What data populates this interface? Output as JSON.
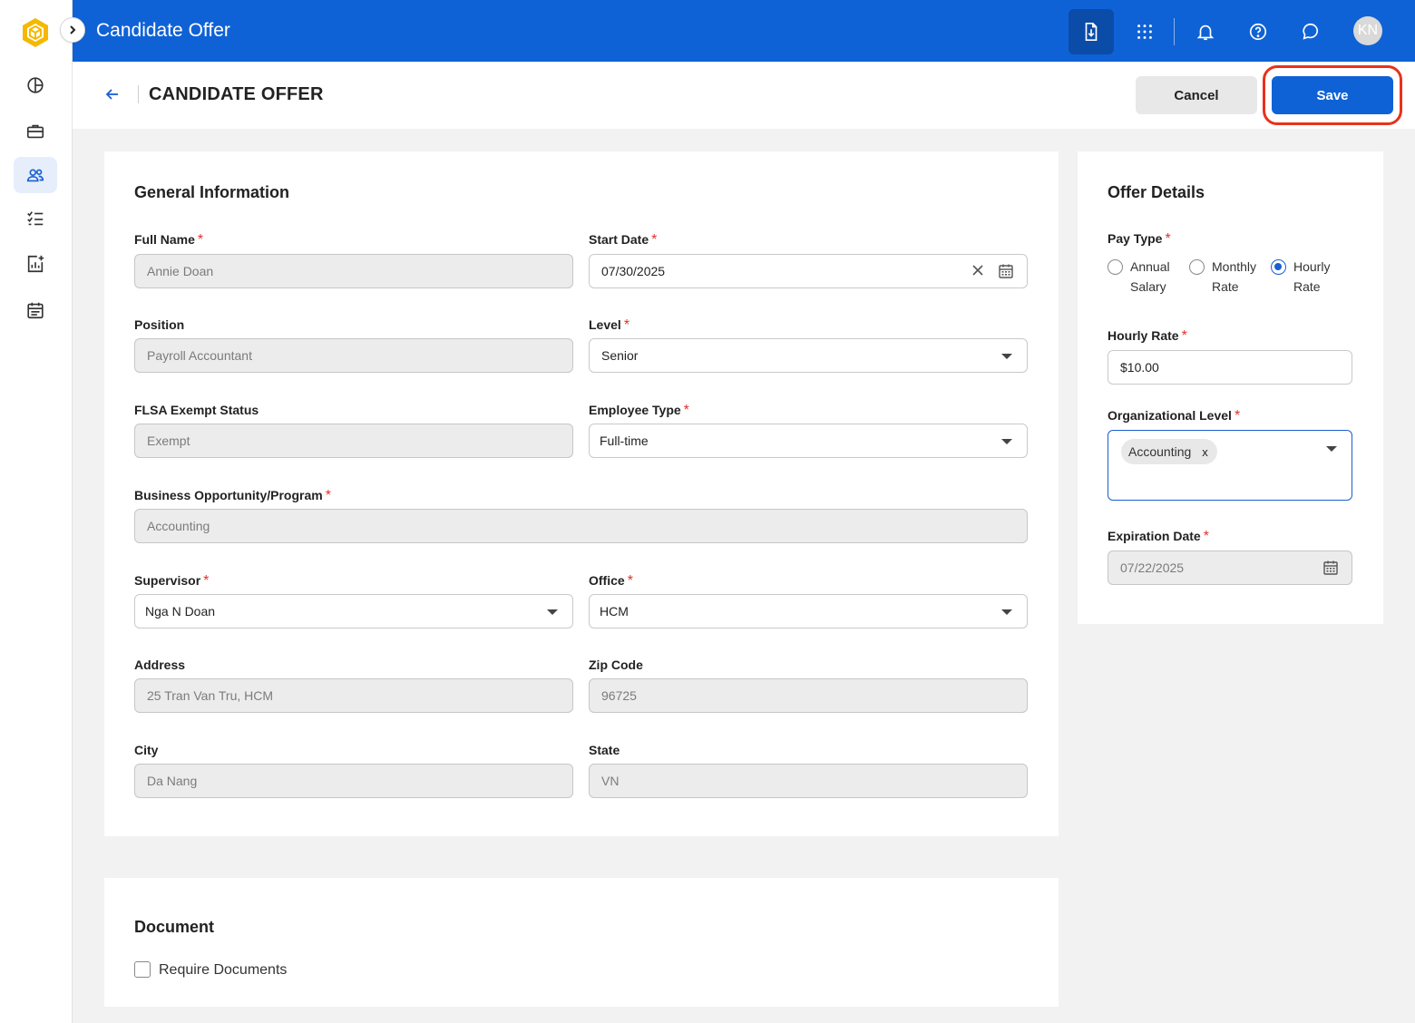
{
  "app": {
    "title": "Candidate Offer",
    "avatar_initials": "KN",
    "accent_color": "#0f62d6"
  },
  "nav": {
    "items": [
      {
        "icon": "dashboard-icon"
      },
      {
        "icon": "briefcase-icon"
      },
      {
        "icon": "people-icon",
        "active": true
      },
      {
        "icon": "checklist-icon"
      },
      {
        "icon": "report-icon"
      },
      {
        "icon": "calendar-icon"
      }
    ]
  },
  "topbar": {
    "icons": [
      "download-doc-icon",
      "apps-grid-icon",
      "bell-icon",
      "help-icon",
      "chat-icon"
    ]
  },
  "page": {
    "title": "CANDIDATE OFFER",
    "cancel_label": "Cancel",
    "save_label": "Save"
  },
  "general": {
    "title": "General Information",
    "full_name": {
      "label": "Full Name",
      "value": "Annie Doan"
    },
    "start_date": {
      "label": "Start Date",
      "value": "07/30/2025"
    },
    "position": {
      "label": "Position",
      "value": "Payroll Accountant"
    },
    "level": {
      "label": "Level",
      "value": "Senior"
    },
    "flsa": {
      "label": "FLSA Exempt Status",
      "value": "Exempt"
    },
    "employee_type": {
      "label": "Employee Type",
      "value": "Full-time"
    },
    "business": {
      "label": "Business Opportunity/Program",
      "value": "Accounting"
    },
    "supervisor": {
      "label": "Supervisor",
      "value": "Nga N Doan"
    },
    "office": {
      "label": "Office",
      "value": "HCM"
    },
    "address": {
      "label": "Address",
      "value": "25 Tran Van Tru, HCM"
    },
    "zip": {
      "label": "Zip Code",
      "value": "96725"
    },
    "city": {
      "label": "City",
      "value": "Da Nang"
    },
    "state": {
      "label": "State",
      "value": "VN"
    }
  },
  "offer": {
    "title": "Offer Details",
    "pay_type": {
      "label": "Pay Type",
      "options": [
        {
          "line1": "Annual",
          "line2": "Salary",
          "selected": false
        },
        {
          "line1": "Monthly",
          "line2": "Rate",
          "selected": false
        },
        {
          "line1": "Hourly",
          "line2": "Rate",
          "selected": true
        }
      ]
    },
    "hourly_rate": {
      "label": "Hourly Rate",
      "value": "$10.00"
    },
    "org_level": {
      "label": "Organizational Level",
      "chip": "Accounting",
      "chip_remove": "x"
    },
    "expiration": {
      "label": "Expiration Date",
      "value": "07/22/2025"
    }
  },
  "document": {
    "title": "Document",
    "require_label": "Require Documents",
    "require_checked": false
  }
}
